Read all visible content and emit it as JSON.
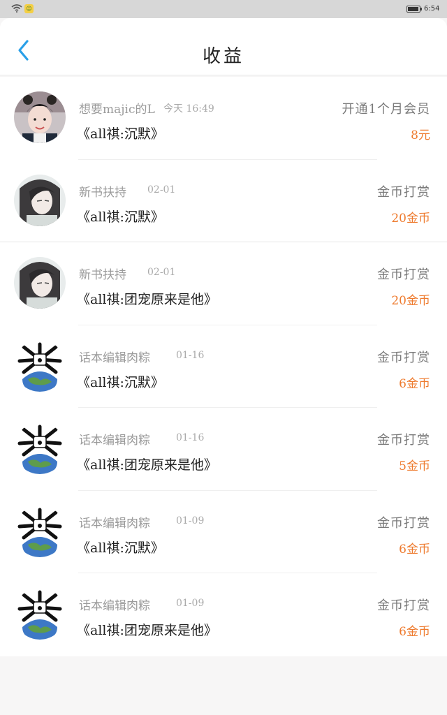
{
  "status_bar": {
    "time": "6:54"
  },
  "header": {
    "title": "收益"
  },
  "colors": {
    "accent_blue": "#2aa0e8",
    "amount_orange": "#ee7a2d"
  },
  "rows": [
    {
      "name": "想要majic的L",
      "date": "今天 16:49",
      "type": "开通1个月会员",
      "book": "《all祺:沉默》",
      "amount": "8元",
      "avatar_icon": "person-photo-avatar"
    },
    {
      "name": "新书扶持",
      "date": "02-01",
      "type": "金币打赏",
      "book": "《all祺:沉默》",
      "amount": "20金币",
      "avatar_icon": "illustrated-character-avatar"
    },
    {
      "name": "新书扶持",
      "date": "02-01",
      "type": "金币打赏",
      "book": "《all祺:团宠原来是他》",
      "amount": "20金币",
      "avatar_icon": "illustrated-character-avatar"
    },
    {
      "name": "话本编辑肉粽",
      "date": "01-16",
      "type": "金币打赏",
      "book": "《all祺:沉默》",
      "amount": "6金币",
      "avatar_icon": "globe-bones-avatar"
    },
    {
      "name": "话本编辑肉粽",
      "date": "01-16",
      "type": "金币打赏",
      "book": "《all祺:团宠原来是他》",
      "amount": "5金币",
      "avatar_icon": "globe-bones-avatar"
    },
    {
      "name": "话本编辑肉粽",
      "date": "01-09",
      "type": "金币打赏",
      "book": "《all祺:沉默》",
      "amount": "6金币",
      "avatar_icon": "globe-bones-avatar"
    },
    {
      "name": "话本编辑肉粽",
      "date": "01-09",
      "type": "金币打赏",
      "book": "《all祺:团宠原来是他》",
      "amount": "6金币",
      "avatar_icon": "globe-bones-avatar"
    }
  ]
}
